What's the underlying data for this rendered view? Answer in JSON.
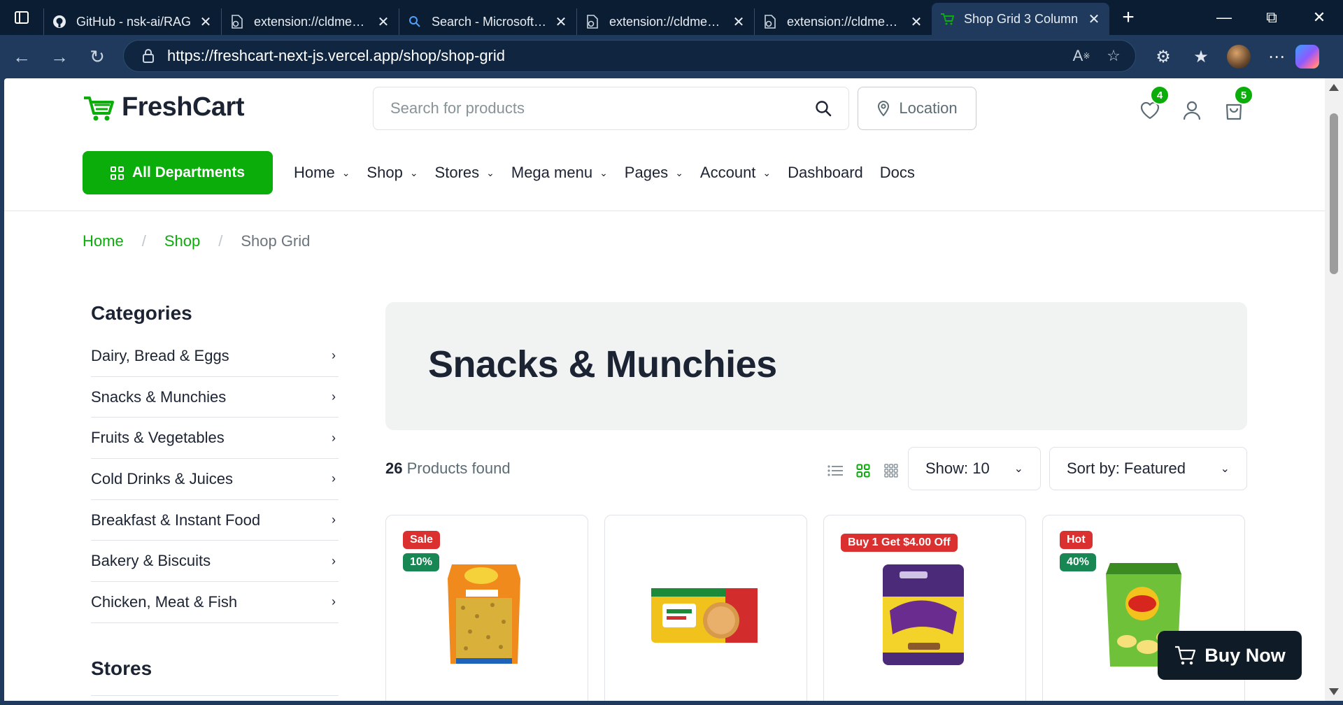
{
  "browser": {
    "tabs": [
      {
        "title": "GitHub - nsk-ai/RAG",
        "icon": "github-icon"
      },
      {
        "title": "extension://cldmemdnllncchfahbcnjijheaolemfk",
        "icon": "extension-page-icon"
      },
      {
        "title": "Search - Microsoft Bing",
        "icon": "search-icon"
      },
      {
        "title": "extension://cldmemdnllncchfahbcnjijheaolemfk",
        "icon": "extension-page-icon"
      },
      {
        "title": "extension://cldmemdnllncchfahbcnjijheaolemfk",
        "icon": "extension-page-icon"
      },
      {
        "title": "Shop Grid 3 Column",
        "icon": "freshcart-cart-icon",
        "active": true
      }
    ],
    "url": "https://freshcart-next-js.vercel.app/shop/shop-grid"
  },
  "header": {
    "logo_text": "FreshCart",
    "search_placeholder": "Search for products",
    "location_label": "Location",
    "wishlist_count": "4",
    "cart_count": "5"
  },
  "nav": {
    "all_departments": "All Departments",
    "items": [
      {
        "label": "Home",
        "dropdown": true
      },
      {
        "label": "Shop",
        "dropdown": true
      },
      {
        "label": "Stores",
        "dropdown": true
      },
      {
        "label": "Mega menu",
        "dropdown": true
      },
      {
        "label": "Pages",
        "dropdown": true
      },
      {
        "label": "Account",
        "dropdown": true
      },
      {
        "label": "Dashboard",
        "dropdown": false
      },
      {
        "label": "Docs",
        "dropdown": false
      }
    ]
  },
  "breadcrumb": {
    "home": "Home",
    "shop": "Shop",
    "current": "Shop Grid",
    "separator": "/"
  },
  "sidebar": {
    "categories_title": "Categories",
    "categories": [
      "Dairy, Bread & Eggs",
      "Snacks & Munchies",
      "Fruits & Vegetables",
      "Cold Drinks & Juices",
      "Breakfast & Instant Food",
      "Bakery & Biscuits",
      "Chicken, Meat & Fish"
    ],
    "stores_title": "Stores"
  },
  "main": {
    "banner_title": "Snacks & Munchies",
    "products_count": "26",
    "products_found_text": "Products found",
    "show_label": "Show: 10",
    "sort_label": "Sort by: Featured"
  },
  "products": [
    {
      "badges": [
        {
          "text": "Sale",
          "color": "#db3030"
        },
        {
          "text": "10%",
          "color": "#198754"
        }
      ],
      "image": "haldirams-bhujia-sev-pack"
    },
    {
      "badges": [],
      "image": "nutri-choice-digestive-biscuit-pack"
    },
    {
      "badges": [
        {
          "text": "Buy 1 Get $4.00 Off",
          "color": "#db3030"
        }
      ],
      "image": "cadbury-5star-bites-pack"
    },
    {
      "badges": [
        {
          "text": "Hot",
          "color": "#db3030"
        },
        {
          "text": "40%",
          "color": "#198754"
        }
      ],
      "image": "lays-chips-pack"
    }
  ],
  "buy_now": "Buy Now",
  "colors": {
    "brand_green": "#0aad0a",
    "sale_red": "#db3030",
    "discount_green": "#198754",
    "dark": "#1c2333"
  }
}
